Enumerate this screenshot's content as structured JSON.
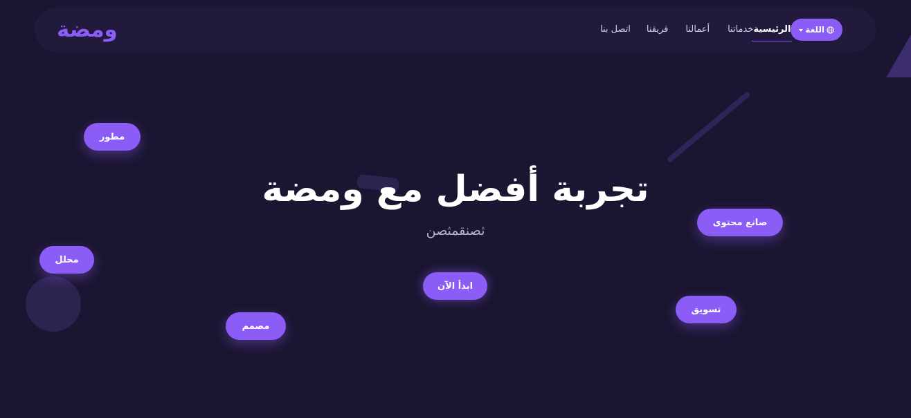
{
  "header": {
    "logo": "ومضة",
    "nav": {
      "home": "الرئيسية",
      "services": "خدماتنا",
      "works": "أعمالنا",
      "team": "فريقنا",
      "contact": "اتصل بنا"
    },
    "language_button": {
      "label": "اللغة",
      "icon": "globe-icon"
    }
  },
  "hero": {
    "title": "تجربة أفضل مع ومضة",
    "subtitle": "ثصنقمثصن",
    "cta_label": "ابدأ الآن"
  },
  "floating_tags": {
    "developer": "مطور",
    "analyst": "محلل",
    "designer": "مصمم",
    "content_creator": "صانع محتوى",
    "marketing": "تسويق"
  },
  "colors": {
    "background": "#1a1530",
    "navbar": "#211a3c",
    "accent": "#8b5cf6",
    "text": "#ffffff",
    "muted_text": "#b9b3cc"
  }
}
